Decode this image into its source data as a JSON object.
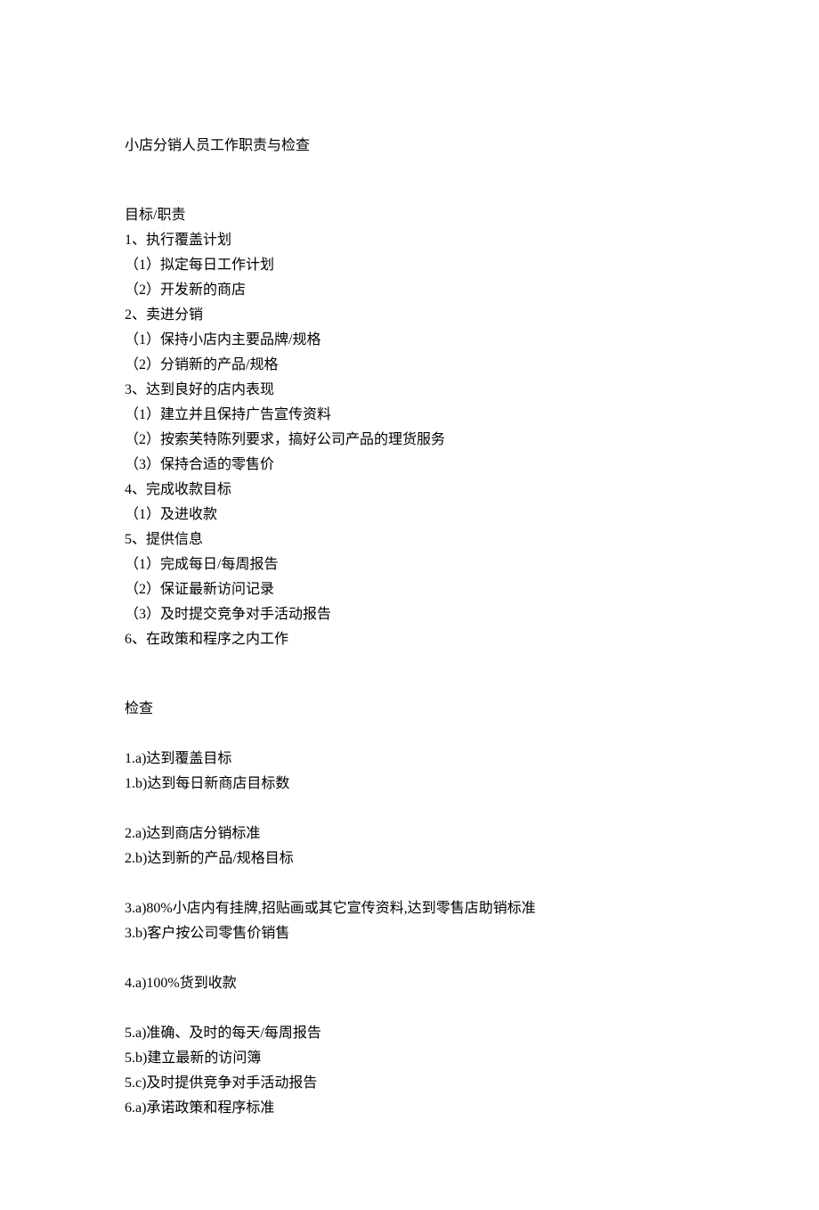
{
  "title": "小店分销人员工作职责与检查",
  "section1": {
    "header": "目标/职责",
    "items": [
      "1、执行覆盖计划",
      "（1）拟定每日工作计划",
      "（2）开发新的商店",
      "2、卖进分销",
      "（1）保持小店内主要品牌/规格",
      "（2）分销新的产品/规格",
      "3、达到良好的店内表现",
      "（1）建立并且保持广告宣传资料",
      "（2）按索芙特陈列要求，搞好公司产品的理货服务",
      "（3）保持合适的零售价",
      "4、完成收款目标",
      "（1）及进收款",
      "5、提供信息",
      "（1）完成每日/每周报告",
      "（2）保证最新访问记录",
      "（3）及时提交竞争对手活动报告",
      "6、在政策和程序之内工作"
    ]
  },
  "section2": {
    "header": "检查",
    "groups": [
      [
        "1.a)达到覆盖目标",
        "1.b)达到每日新商店目标数"
      ],
      [
        "2.a)达到商店分销标准",
        "2.b)达到新的产品/规格目标"
      ],
      [
        "3.a)80%小店内有挂牌,招贴画或其它宣传资料,达到零售店助销标准",
        "3.b)客户按公司零售价销售"
      ],
      [
        "4.a)100%货到收款"
      ],
      [
        "5.a)准确、及时的每天/每周报告",
        "5.b)建立最新的访问簿",
        "5.c)及时提供竞争对手活动报告",
        "6.a)承诺政策和程序标准"
      ]
    ]
  }
}
